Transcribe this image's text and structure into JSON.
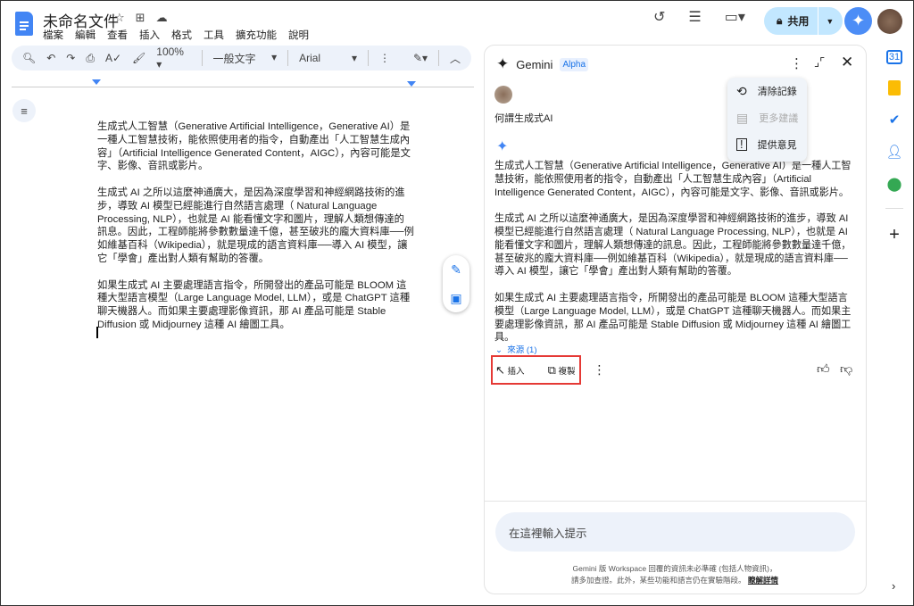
{
  "doc": {
    "title": "未命名文件",
    "menu": [
      "檔案",
      "編輯",
      "查看",
      "插入",
      "格式",
      "工具",
      "擴充功能",
      "說明"
    ],
    "toolbar": {
      "zoom": "100%",
      "style": "一般文字",
      "font": "Arial"
    },
    "paragraphs": [
      "生成式人工智慧（Generative Artificial Intelligence，Generative AI）是一種人工智慧技術，能依照使用者的指令，自動產出「人工智慧生成內容」（Artificial Intelligence Generated Content，AIGC），內容可能是文字、影像、音訊或影片。",
      "生成式 AI 之所以這麼神通廣大，是因為深度學習和神經網路技術的進步，導致 AI 模型已經能進行自然語言處理（ Natural Language Processing, NLP），也就是 AI 能看懂文字和圖片，理解人類想傳達的訊息。因此，工程師能將參數數量達千億，甚至破兆的龐大資料庫──例如維基百科（Wikipedia），就是現成的語言資料庫──導入 AI 模型，讓它「學會」產出對人類有幫助的答覆。",
      "如果生成式 AI 主要處理語言指令，所開發出的產品可能是 BLOOM 這種大型語言模型（Large Language Model, LLM），或是 ChatGPT 這種聊天機器人。而如果主要處理影像資訊，那 AI 產品可能是 Stable Diffusion 或 Midjourney 這種 AI 繪圖工具。"
    ]
  },
  "header": {
    "share": "共用"
  },
  "gemini": {
    "title": "Gemini",
    "badge": "Alpha",
    "prompt": "何謂生成式AI",
    "menu": [
      "清除記錄",
      "更多建議",
      "提供意見"
    ],
    "response": [
      "生成式人工智慧（Generative Artificial Intelligence，Generative AI）是一種人工智慧技術，能依照使用者的指令，自動產出「人工智慧生成內容」（Artificial Intelligence Generated Content，AIGC），內容可能是文字、影像、音訊或影片。",
      "生成式 AI 之所以這麼神通廣大，是因為深度學習和神經網路技術的進步，導致 AI 模型已經能進行自然語言處理（ Natural Language Processing, NLP），也就是 AI 能看懂文字和圖片，理解人類想傳達的訊息。因此，工程師能將參數數量達千億，甚至破兆的龐大資料庫──例如維基百科（Wikipedia），就是現成的語言資料庫──導入 AI 模型，讓它「學會」產出對人類有幫助的答覆。",
      "如果生成式 AI 主要處理語言指令，所開發出的產品可能是 BLOOM 這種大型語言模型（Large Language Model, LLM），或是 ChatGPT 這種聊天機器人。而如果主要處理影像資訊，那 AI 產品可能是 Stable Diffusion 或 Midjourney 這種 AI 繪圖工具。"
    ],
    "sources": "來源 (1)",
    "insert": "插入",
    "copy": "複製",
    "input_placeholder": "在這裡輸入提示",
    "disclaimer1": "Gemini 版 Workspace 回覆的資訊未必準確 (包括人物資訊)，",
    "disclaimer2": "請多加查證。此外，某些功能和語言仍在實驗階段。",
    "learn_more": "瞭解詳情"
  },
  "colors": {
    "accent": "#1a73e8",
    "share_bg": "#c2e7ff",
    "highlight": "#e53935"
  }
}
